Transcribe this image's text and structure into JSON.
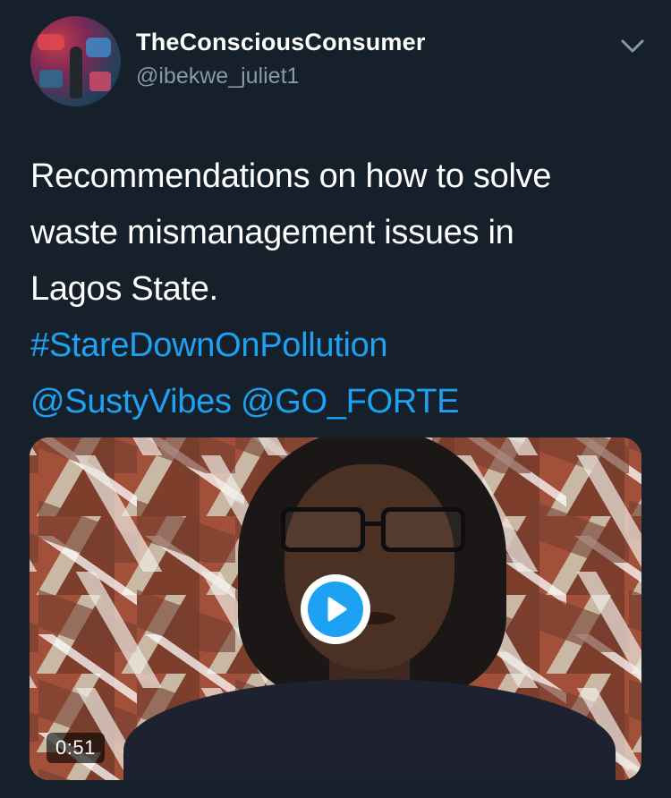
{
  "author": {
    "display_name": "TheConsciousConsumer",
    "handle": "@ibekwe_juliet1"
  },
  "tweet": {
    "text_lines": [
      "Recommendations on how to solve",
      "waste mismanagement issues in",
      "Lagos State."
    ],
    "hashtag": "#StareDownOnPollution",
    "mention_1": "@SustyVibes",
    "mention_2": "@GO_FORTE"
  },
  "media": {
    "type": "video",
    "duration": "0:51"
  },
  "icons": {
    "menu": "chevron-down-icon",
    "play": "play-icon"
  },
  "colors": {
    "background": "#15202b",
    "link": "#1da1f2",
    "secondary_text": "#8899a6"
  }
}
